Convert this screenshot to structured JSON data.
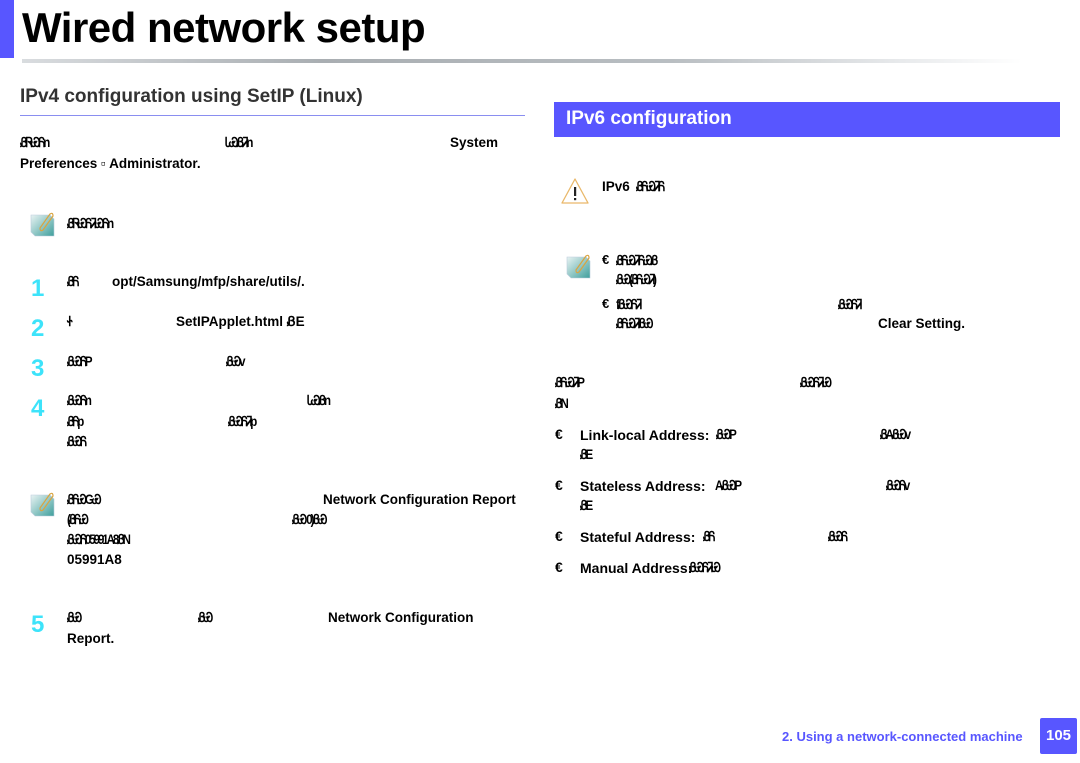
{
  "page": {
    "title": "Wired network setup",
    "accent_color": "#5856ff",
    "step_color": "#3de3fa"
  },
  "left": {
    "heading": "IPv4 configuration using SetIP (Linux)",
    "intro": {
      "line1_a": "ᏰᏒᏯᏲn",
      "line1_b": "ᏓᏯᏰᏘn",
      "line1_c": "System",
      "line2": "Preferences ▫ Administrator."
    },
    "note1": {
      "text": "ᏰᏒᏯᏲᏘᏯᏲn"
    },
    "steps": [
      {
        "num": "1",
        "a": "ᏰᏲ",
        "b": "opt/Samsung/mfp/share/utils/."
      },
      {
        "num": "2",
        "a": "Ꮠ",
        "b": "SetIPApplet.html ᏰE"
      },
      {
        "num": "3",
        "a": "ᏰᏯᏲP",
        "b": "ᏰᏯv"
      },
      {
        "num": "4",
        "a1": "ᏰᏯᏲn",
        "b1": "ᏓᏯᏰn",
        "a2": "ᏰᏲp",
        "b2": "ᏰᏯᏲᏘp",
        "a3": "ᏰᏯᏲ"
      },
      {
        "num": "5",
        "a": "ᏰᏯ",
        "b": "ᏰᏯ",
        "c": "Network Configuration",
        "d": "Report."
      }
    ],
    "note2": {
      "l1a": "ᏰᏲᏯGᏯ",
      "l1b": "Network Configuration Report",
      "l2a": "(ᏰᏲᏯ",
      "l2b": "ᏰᏯ 0)ᏰᏯ",
      "l3": "ᏰᏯᏲ05991A8ᏰN",
      "l4": "05991A8"
    }
  },
  "right": {
    "heading": "IPv6 configuration",
    "caution": {
      "prefix": "IPv6",
      "text": "ᏰᏲᏯᏘᏲ"
    },
    "note": {
      "b1_l1": "ᏰᏲᏯᏘᏲᏯᏰ",
      "b1_l2": "ᏰᏯ(ᏰᏲᏯᏘ)",
      "b2_l1a": "fᏰᏯᏲᏘ",
      "b2_l1b": "ᏰᏯᏲᏘ",
      "b2_l2a": "ᏰᏲᏯᏘᏰᏯ",
      "b2_l2b": "Clear Setting."
    },
    "intro": {
      "l1a": "ᏰᏲᏯᏘP",
      "l1b": "ᏰᏯᏲᏘᏯ",
      "l2": "ᏰN"
    },
    "bullet_glyph": "€",
    "address_types": [
      {
        "label": "Link-local Address:",
        "tail1": "ᏰᏯP",
        "tail2": "ᏰAᏰᏯv",
        "line2": "ᏰE"
      },
      {
        "label": "Stateless Address:",
        "tail1": "AᏰᏯP",
        "tail2": "ᏰᏯᏲv",
        "line2": "ᏰE"
      },
      {
        "label": "Stateful Address:",
        "tail1": "ᏰᏲ",
        "tail2": "ᏰᏯᏲ"
      },
      {
        "label": "Manual Address:",
        "tail1": "ᏰᏯᏲᏘᏯ"
      }
    ]
  },
  "footer": {
    "chapter": "2.  Using a network-connected machine",
    "page_number": "105"
  }
}
